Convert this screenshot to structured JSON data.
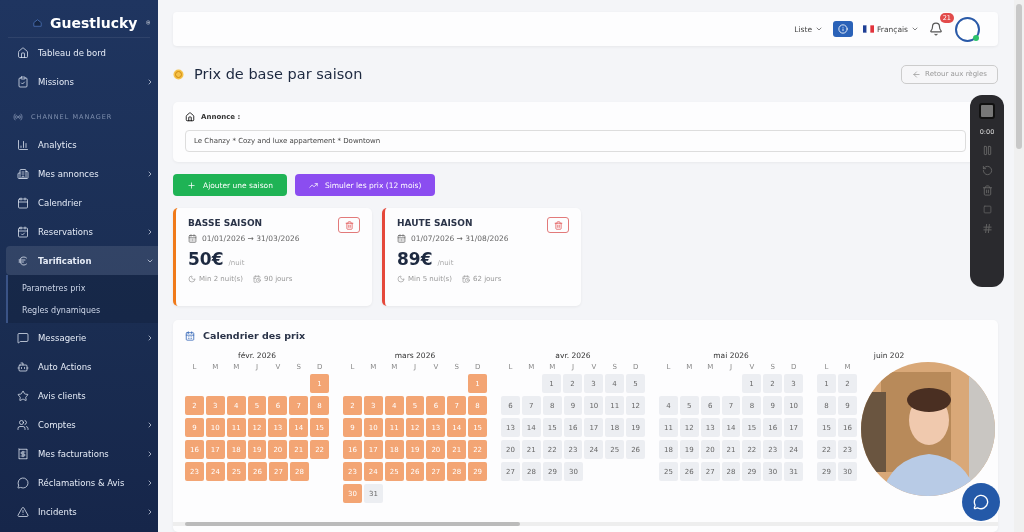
{
  "sidebar": {
    "brand": "Guestlucky",
    "items": [
      {
        "kind": "item",
        "label": "Tableau de bord",
        "has_submenu": false,
        "selected": false
      },
      {
        "kind": "item",
        "label": "Missions",
        "has_submenu": true,
        "selected": false
      },
      {
        "kind": "section",
        "label": "CHANNEL MANAGER"
      },
      {
        "kind": "item",
        "label": "Analytics",
        "has_submenu": false,
        "selected": false
      },
      {
        "kind": "item",
        "label": "Mes annonces",
        "has_submenu": true,
        "selected": false
      },
      {
        "kind": "item",
        "label": "Calendrier",
        "has_submenu": false,
        "selected": false
      },
      {
        "kind": "item",
        "label": "Reservations",
        "has_submenu": true,
        "selected": false
      },
      {
        "kind": "item",
        "label": "Tarification",
        "has_submenu": true,
        "selected": true,
        "expanded": true,
        "children": [
          {
            "label": "Parametres prix"
          },
          {
            "label": "Regles dynamiques"
          }
        ]
      },
      {
        "kind": "item",
        "label": "Messagerie",
        "has_submenu": true,
        "selected": false
      },
      {
        "kind": "item",
        "label": "Auto Actions",
        "has_submenu": false,
        "selected": false
      },
      {
        "kind": "item",
        "label": "Avis clients",
        "has_submenu": false,
        "selected": false
      },
      {
        "kind": "item",
        "label": "Comptes",
        "has_submenu": true,
        "selected": false
      },
      {
        "kind": "item",
        "label": "Mes facturations",
        "has_submenu": true,
        "selected": false
      },
      {
        "kind": "item",
        "label": "Réclamations & Avis",
        "has_submenu": true,
        "selected": false
      },
      {
        "kind": "item",
        "label": "Incidents",
        "has_submenu": true,
        "selected": false
      }
    ]
  },
  "topbar": {
    "view": "Liste",
    "language": "Français",
    "notifications": "21"
  },
  "page": {
    "title": "Prix de base par saison",
    "back": "Retour aux règles"
  },
  "listing": {
    "label": "Annonce :",
    "value": "Le Chanzy * Cozy and luxe appartement * Downtown"
  },
  "actions": [
    {
      "kind": "add",
      "label": "Ajouter une saison"
    },
    {
      "kind": "simulate",
      "label": "Simuler les prix (12 mois)"
    }
  ],
  "seasons": [
    {
      "name": "BASSE SAISON",
      "dates": "01/01/2026 → 31/03/2026",
      "price": "50€",
      "unit": "/nuit",
      "min": "Min 2 nuit(s)",
      "days": "90 jours",
      "color": "#f07a1a"
    },
    {
      "name": "HAUTE SAISON",
      "dates": "01/07/2026 → 31/08/2026",
      "price": "89€",
      "unit": "/nuit",
      "min": "Min 5 nuit(s)",
      "days": "62 jours",
      "color": "#e5483a"
    }
  ],
  "calendar": {
    "title": "Calendrier des prix",
    "months": [
      {
        "title": "févr. 2026",
        "weekdays": [
          "L",
          "M",
          "M",
          "J",
          "V",
          "S",
          "D"
        ],
        "weeks": [
          {
            "kind": "leading",
            "days": [
              {
                "day": "1",
                "priced": true
              }
            ]
          },
          {
            "kind": "trailing",
            "days": [
              {
                "day": "2",
                "priced": true
              },
              {
                "day": "3",
                "priced": true
              },
              {
                "day": "4",
                "priced": true
              },
              {
                "day": "5",
                "priced": true
              },
              {
                "day": "6",
                "priced": true
              },
              {
                "day": "7",
                "priced": true
              },
              {
                "day": "8",
                "priced": true
              }
            ]
          },
          {
            "kind": "trailing",
            "days": [
              {
                "day": "9",
                "priced": true
              },
              {
                "day": "10",
                "priced": true
              },
              {
                "day": "11",
                "priced": true
              },
              {
                "day": "12",
                "priced": true
              },
              {
                "day": "13",
                "priced": true
              },
              {
                "day": "14",
                "priced": true
              },
              {
                "day": "15",
                "priced": true
              }
            ]
          },
          {
            "kind": "trailing",
            "days": [
              {
                "day": "16",
                "priced": true
              },
              {
                "day": "17",
                "priced": true
              },
              {
                "day": "18",
                "priced": true
              },
              {
                "day": "19",
                "priced": true
              },
              {
                "day": "20",
                "priced": true
              },
              {
                "day": "21",
                "priced": true
              },
              {
                "day": "22",
                "priced": true
              }
            ]
          },
          {
            "kind": "trailing",
            "days": [
              {
                "day": "23",
                "priced": true
              },
              {
                "day": "24",
                "priced": true
              },
              {
                "day": "25",
                "priced": true
              },
              {
                "day": "26",
                "priced": true
              },
              {
                "day": "27",
                "priced": true
              },
              {
                "day": "28",
                "priced": true
              }
            ]
          }
        ]
      },
      {
        "title": "mars 2026",
        "weekdays": [
          "L",
          "M",
          "M",
          "J",
          "V",
          "S",
          "D"
        ],
        "weeks": [
          {
            "kind": "leading",
            "days": [
              {
                "day": "1",
                "priced": true
              }
            ]
          },
          {
            "kind": "trailing",
            "days": [
              {
                "day": "2",
                "priced": true
              },
              {
                "day": "3",
                "priced": true
              },
              {
                "day": "4",
                "priced": true
              },
              {
                "day": "5",
                "priced": true
              },
              {
                "day": "6",
                "priced": true
              },
              {
                "day": "7",
                "priced": true
              },
              {
                "day": "8",
                "priced": true
              }
            ]
          },
          {
            "kind": "trailing",
            "days": [
              {
                "day": "9",
                "priced": true
              },
              {
                "day": "10",
                "priced": true
              },
              {
                "day": "11",
                "priced": true
              },
              {
                "day": "12",
                "priced": true
              },
              {
                "day": "13",
                "priced": true
              },
              {
                "day": "14",
                "priced": true
              },
              {
                "day": "15",
                "priced": true
              }
            ]
          },
          {
            "kind": "trailing",
            "days": [
              {
                "day": "16",
                "priced": true
              },
              {
                "day": "17",
                "priced": true
              },
              {
                "day": "18",
                "priced": true
              },
              {
                "day": "19",
                "priced": true
              },
              {
                "day": "20",
                "priced": true
              },
              {
                "day": "21",
                "priced": true
              },
              {
                "day": "22",
                "priced": true
              }
            ]
          },
          {
            "kind": "trailing",
            "days": [
              {
                "day": "23",
                "priced": true
              },
              {
                "day": "24",
                "priced": true
              },
              {
                "day": "25",
                "priced": true
              },
              {
                "day": "26",
                "priced": true
              },
              {
                "day": "27",
                "priced": true
              },
              {
                "day": "28",
                "priced": true
              },
              {
                "day": "29",
                "priced": true
              }
            ]
          },
          {
            "kind": "trailing",
            "days": [
              {
                "day": "30",
                "priced": true
              },
              {
                "day": "31",
                "priced": false
              }
            ]
          }
        ]
      },
      {
        "title": "avr. 2026",
        "weekdays": [
          "L",
          "M",
          "M",
          "J",
          "V",
          "S",
          "D"
        ],
        "weeks": [
          {
            "kind": "leading",
            "days": [
              {
                "day": "1",
                "priced": false
              },
              {
                "day": "2",
                "priced": false
              },
              {
                "day": "3",
                "priced": false
              },
              {
                "day": "4",
                "priced": false
              },
              {
                "day": "5",
                "priced": false
              }
            ]
          },
          {
            "kind": "trailing",
            "days": [
              {
                "day": "6",
                "priced": false
              },
              {
                "day": "7",
                "priced": false
              },
              {
                "day": "8",
                "priced": false
              },
              {
                "day": "9",
                "priced": false
              },
              {
                "day": "10",
                "priced": false
              },
              {
                "day": "11",
                "priced": false
              },
              {
                "day": "12",
                "priced": false
              }
            ]
          },
          {
            "kind": "trailing",
            "days": [
              {
                "day": "13",
                "priced": false
              },
              {
                "day": "14",
                "priced": false
              },
              {
                "day": "15",
                "priced": false
              },
              {
                "day": "16",
                "priced": false
              },
              {
                "day": "17",
                "priced": false
              },
              {
                "day": "18",
                "priced": false
              },
              {
                "day": "19",
                "priced": false
              }
            ]
          },
          {
            "kind": "trailing",
            "days": [
              {
                "day": "20",
                "priced": false
              },
              {
                "day": "21",
                "priced": false
              },
              {
                "day": "22",
                "priced": false
              },
              {
                "day": "23",
                "priced": false
              },
              {
                "day": "24",
                "priced": false
              },
              {
                "day": "25",
                "priced": false
              },
              {
                "day": "26",
                "priced": false
              }
            ]
          },
          {
            "kind": "trailing",
            "days": [
              {
                "day": "27",
                "priced": false
              },
              {
                "day": "28",
                "priced": false
              },
              {
                "day": "29",
                "priced": false
              },
              {
                "day": "30",
                "priced": false
              }
            ]
          }
        ]
      },
      {
        "title": "mai 2026",
        "weekdays": [
          "L",
          "M",
          "M",
          "J",
          "V",
          "S",
          "D"
        ],
        "weeks": [
          {
            "kind": "leading",
            "days": [
              {
                "day": "1",
                "priced": false
              },
              {
                "day": "2",
                "priced": false
              },
              {
                "day": "3",
                "priced": false
              }
            ]
          },
          {
            "kind": "trailing",
            "days": [
              {
                "day": "4",
                "priced": false
              },
              {
                "day": "5",
                "priced": false
              },
              {
                "day": "6",
                "priced": false
              },
              {
                "day": "7",
                "priced": false
              },
              {
                "day": "8",
                "priced": false
              },
              {
                "day": "9",
                "priced": false
              },
              {
                "day": "10",
                "priced": false
              }
            ]
          },
          {
            "kind": "trailing",
            "days": [
              {
                "day": "11",
                "priced": false
              },
              {
                "day": "12",
                "priced": false
              },
              {
                "day": "13",
                "priced": false
              },
              {
                "day": "14",
                "priced": false
              },
              {
                "day": "15",
                "priced": false
              },
              {
                "day": "16",
                "priced": false
              },
              {
                "day": "17",
                "priced": false
              }
            ]
          },
          {
            "kind": "trailing",
            "days": [
              {
                "day": "18",
                "priced": false
              },
              {
                "day": "19",
                "priced": false
              },
              {
                "day": "20",
                "priced": false
              },
              {
                "day": "21",
                "priced": false
              },
              {
                "day": "22",
                "priced": false
              },
              {
                "day": "23",
                "priced": false
              },
              {
                "day": "24",
                "priced": false
              }
            ]
          },
          {
            "kind": "trailing",
            "days": [
              {
                "day": "25",
                "priced": false
              },
              {
                "day": "26",
                "priced": false
              },
              {
                "day": "27",
                "priced": false
              },
              {
                "day": "28",
                "priced": false
              },
              {
                "day": "29",
                "priced": false
              },
              {
                "day": "30",
                "priced": false
              },
              {
                "day": "31",
                "priced": false
              }
            ]
          }
        ]
      },
      {
        "title": "juin 202",
        "weekdays": [
          "L",
          "M"
        ],
        "weeks": [
          {
            "kind": "trailing",
            "days": [
              {
                "day": "1",
                "priced": false
              },
              {
                "day": "2",
                "priced": false
              }
            ]
          },
          {
            "kind": "trailing",
            "days": [
              {
                "day": "8",
                "priced": false
              },
              {
                "day": "9",
                "priced": false
              }
            ]
          },
          {
            "kind": "trailing",
            "days": [
              {
                "day": "15",
                "priced": false
              },
              {
                "day": "16",
                "priced": false
              }
            ]
          },
          {
            "kind": "trailing",
            "days": [
              {
                "day": "22",
                "priced": false
              },
              {
                "day": "23",
                "priced": false
              }
            ]
          },
          {
            "kind": "trailing",
            "days": [
              {
                "day": "29",
                "priced": false
              },
              {
                "day": "30",
                "priced": false
              }
            ]
          }
        ]
      }
    ]
  },
  "recorder": {
    "time": "0:00"
  }
}
